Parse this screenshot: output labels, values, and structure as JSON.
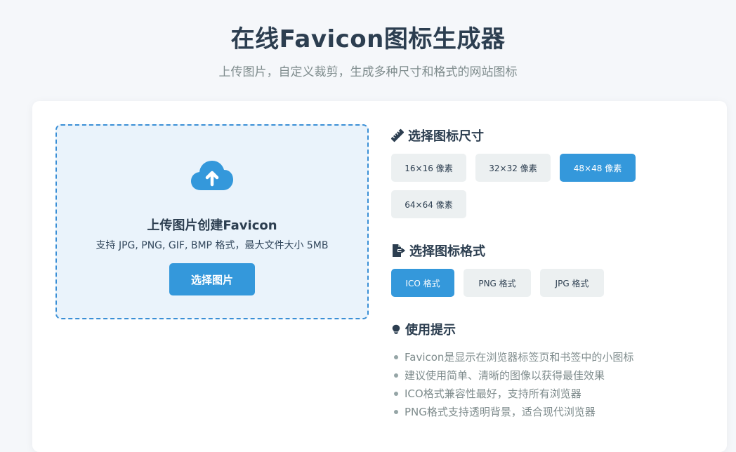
{
  "header": {
    "title": "在线Favicon图标生成器",
    "subtitle": "上传图片，自定义裁剪，生成多种尺寸和格式的网站图标"
  },
  "upload": {
    "icon": "cloud-upload-icon",
    "title": "上传图片创建Favicon",
    "hint": "支持 JPG, PNG, GIF, BMP 格式，最大文件大小 5MB",
    "button_label": "选择图片"
  },
  "sizes": {
    "icon": "ruler-icon",
    "title": "选择图标尺寸",
    "options": [
      {
        "label": "16×16 像素",
        "selected": false
      },
      {
        "label": "32×32 像素",
        "selected": false
      },
      {
        "label": "48×48 像素",
        "selected": true
      },
      {
        "label": "64×64 像素",
        "selected": false
      }
    ]
  },
  "formats": {
    "icon": "file-export-icon",
    "title": "选择图标格式",
    "options": [
      {
        "label": "ICO 格式",
        "selected": true
      },
      {
        "label": "PNG 格式",
        "selected": false
      },
      {
        "label": "JPG 格式",
        "selected": false
      }
    ]
  },
  "tips": {
    "icon": "lightbulb-icon",
    "title": "使用提示",
    "items": [
      "Favicon是显示在浏览器标签页和书签中的小图标",
      "建议使用简单、清晰的图像以获得最佳效果",
      "ICO格式兼容性最好，支持所有浏览器",
      "PNG格式支持透明背景，适合现代浏览器"
    ]
  },
  "colors": {
    "accent": "#3498db",
    "upload_bg": "#eaf3fb",
    "upload_border": "#3a8fd6",
    "option_bg": "#ecf0f1",
    "title_text": "#2c3e50",
    "muted_text": "#7f8c8d"
  }
}
